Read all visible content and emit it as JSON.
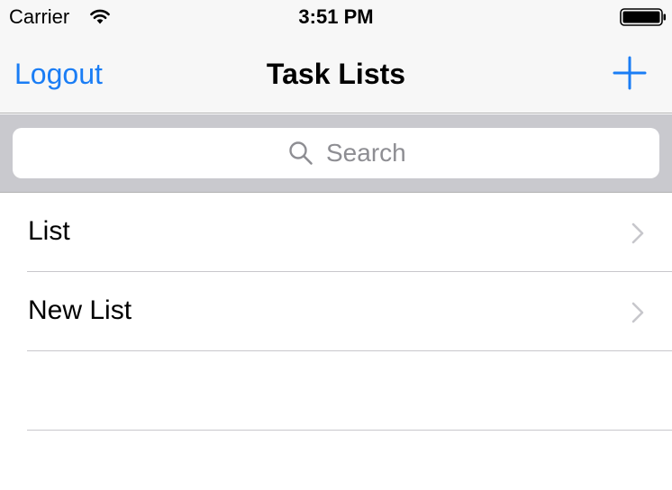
{
  "status_bar": {
    "carrier": "Carrier",
    "time": "3:51 PM",
    "wifi_icon": "wifi-icon",
    "battery_icon": "battery-icon"
  },
  "nav_bar": {
    "left_button": "Logout",
    "title": "Task Lists",
    "right_icon": "plus-icon",
    "tint_color": "#1a7df5"
  },
  "search": {
    "placeholder": "Search",
    "icon": "search-icon"
  },
  "lists": [
    {
      "label": "List"
    },
    {
      "label": "New List"
    }
  ],
  "colors": {
    "nav_background": "#f7f7f7",
    "search_background": "#c9c9ce",
    "separator": "#c8c7cc",
    "placeholder": "#8e8e93",
    "chevron": "#c7c7cc"
  }
}
